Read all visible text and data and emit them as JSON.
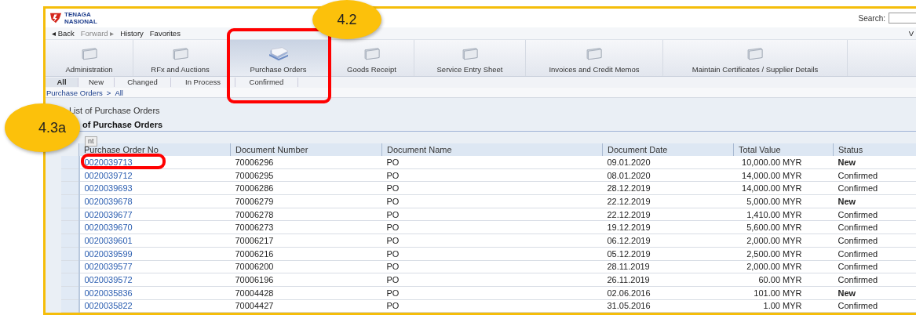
{
  "header": {
    "logo_text": [
      "TENAGA",
      "NASIONAL"
    ],
    "search_label": "Search:"
  },
  "nav": {
    "items": [
      "◂ Back",
      "Forward ▸",
      "History",
      "Favorites"
    ],
    "right_text": "V"
  },
  "tabs": [
    {
      "label": "Administration",
      "selected": false
    },
    {
      "label": "RFx and Auctions",
      "selected": false
    },
    {
      "label": "Purchase Orders",
      "selected": true
    },
    {
      "label": "Goods Receipt",
      "selected": false
    },
    {
      "label": "Service Entry Sheet",
      "selected": false
    },
    {
      "label": "Invoices and Credit Memos",
      "selected": false
    },
    {
      "label": "Maintain Certificates / Supplier Details",
      "selected": false
    }
  ],
  "subtabs": [
    {
      "label": "All",
      "selected": true
    },
    {
      "label": "New",
      "selected": false
    },
    {
      "label": "Changed",
      "selected": false
    },
    {
      "label": "In Process",
      "selected": false
    },
    {
      "label": "Confirmed",
      "selected": false
    }
  ],
  "breadcrumb": [
    "Purchase Orders",
    ">",
    "All"
  ],
  "page_title": "List of Purchase Orders",
  "table": {
    "title": "of Purchase Orders",
    "button": "nt",
    "columns": [
      "Purchase Order No",
      "Document Number",
      "Document Name",
      "Document Date",
      "Total Value",
      "Status"
    ],
    "rows": [
      {
        "po": "0020039713",
        "doc_number": "70006296",
        "doc_name": "PO",
        "date": "09.01.2020",
        "value": "10,000.00 MYR",
        "status": "New",
        "bold": true
      },
      {
        "po": "0020039712",
        "doc_number": "70006295",
        "doc_name": "PO",
        "date": "08.01.2020",
        "value": "14,000.00 MYR",
        "status": "Confirmed",
        "bold": false
      },
      {
        "po": "0020039693",
        "doc_number": "70006286",
        "doc_name": "PO",
        "date": "28.12.2019",
        "value": "14,000.00 MYR",
        "status": "Confirmed",
        "bold": false
      },
      {
        "po": "0020039678",
        "doc_number": "70006279",
        "doc_name": "PO",
        "date": "22.12.2019",
        "value": "5,000.00 MYR",
        "status": "New",
        "bold": true
      },
      {
        "po": "0020039677",
        "doc_number": "70006278",
        "doc_name": "PO",
        "date": "22.12.2019",
        "value": "1,410.00 MYR",
        "status": "Confirmed",
        "bold": false
      },
      {
        "po": "0020039670",
        "doc_number": "70006273",
        "doc_name": "PO",
        "date": "19.12.2019",
        "value": "5,600.00 MYR",
        "status": "Confirmed",
        "bold": false
      },
      {
        "po": "0020039601",
        "doc_number": "70006217",
        "doc_name": "PO",
        "date": "06.12.2019",
        "value": "2,000.00 MYR",
        "status": "Confirmed",
        "bold": false
      },
      {
        "po": "0020039599",
        "doc_number": "70006216",
        "doc_name": "PO",
        "date": "05.12.2019",
        "value": "2,500.00 MYR",
        "status": "Confirmed",
        "bold": false
      },
      {
        "po": "0020039577",
        "doc_number": "70006200",
        "doc_name": "PO",
        "date": "28.11.2019",
        "value": "2,000.00 MYR",
        "status": "Confirmed",
        "bold": false
      },
      {
        "po": "0020039572",
        "doc_number": "70006196",
        "doc_name": "PO",
        "date": "26.11.2019",
        "value": "60.00 MYR",
        "status": "Confirmed",
        "bold": false
      },
      {
        "po": "0020035836",
        "doc_number": "70004428",
        "doc_name": "PO",
        "date": "02.06.2016",
        "value": "101.00 MYR",
        "status": "New",
        "bold": true
      },
      {
        "po": "0020035822",
        "doc_number": "70004427",
        "doc_name": "PO",
        "date": "31.05.2016",
        "value": "1.00 MYR",
        "status": "Confirmed",
        "bold": false
      }
    ]
  },
  "callouts": [
    {
      "label": "4.2"
    },
    {
      "label": "4.3a"
    }
  ]
}
